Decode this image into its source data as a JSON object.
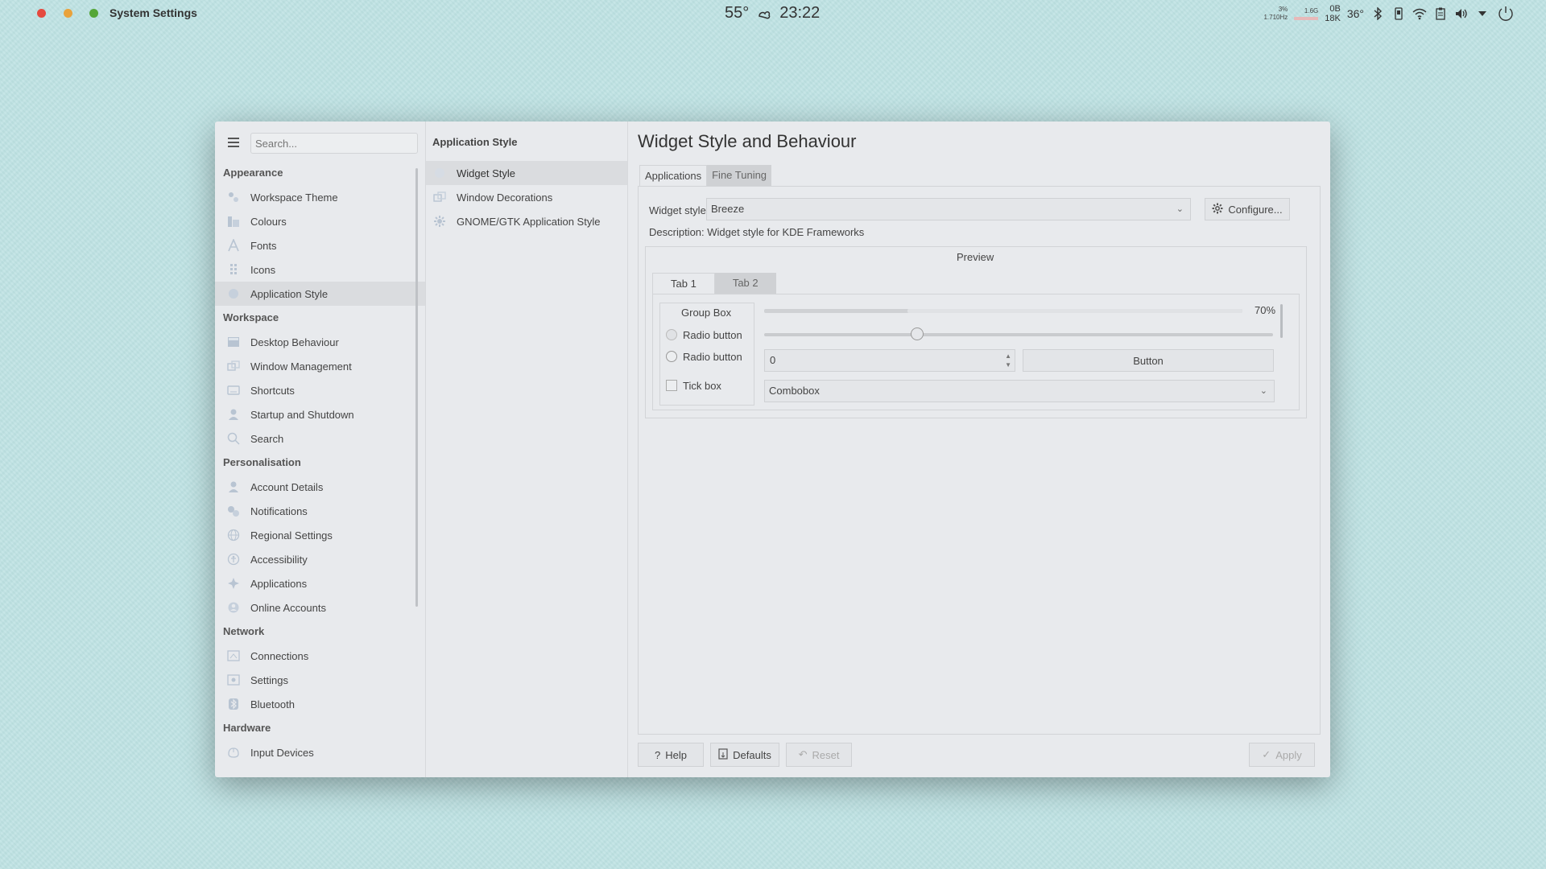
{
  "topbar": {
    "app_title": "System Settings",
    "weather_temp": "55°",
    "clock": "23:22",
    "net_up": "3%",
    "net_freq": "1.710Hz",
    "net_rate": "1.6G",
    "mem_top": "0B",
    "mem_bottom": "18K",
    "cpu_temp": "36°"
  },
  "sidebar": {
    "search_placeholder": "Search...",
    "sections": [
      {
        "heading": "Appearance",
        "items": [
          {
            "label": "Workspace Theme",
            "icon": "workspace-theme-icon"
          },
          {
            "label": "Colours",
            "icon": "colours-icon"
          },
          {
            "label": "Fonts",
            "icon": "fonts-icon"
          },
          {
            "label": "Icons",
            "icon": "icons-icon"
          },
          {
            "label": "Application Style",
            "icon": "application-style-icon"
          }
        ]
      },
      {
        "heading": "Workspace",
        "items": [
          {
            "label": "Desktop Behaviour",
            "icon": "desktop-behaviour-icon"
          },
          {
            "label": "Window Management",
            "icon": "window-management-icon"
          },
          {
            "label": "Shortcuts",
            "icon": "shortcuts-icon"
          },
          {
            "label": "Startup and Shutdown",
            "icon": "startup-shutdown-icon"
          },
          {
            "label": "Search",
            "icon": "search-icon"
          }
        ]
      },
      {
        "heading": "Personalisation",
        "items": [
          {
            "label": "Account Details",
            "icon": "account-details-icon"
          },
          {
            "label": "Notifications",
            "icon": "notifications-icon"
          },
          {
            "label": "Regional Settings",
            "icon": "regional-settings-icon"
          },
          {
            "label": "Accessibility",
            "icon": "accessibility-icon"
          },
          {
            "label": "Applications",
            "icon": "applications-icon"
          },
          {
            "label": "Online Accounts",
            "icon": "online-accounts-icon"
          }
        ]
      },
      {
        "heading": "Network",
        "items": [
          {
            "label": "Connections",
            "icon": "connections-icon"
          },
          {
            "label": "Settings",
            "icon": "network-settings-icon"
          },
          {
            "label": "Bluetooth",
            "icon": "bluetooth-icon"
          }
        ]
      },
      {
        "heading": "Hardware",
        "items": [
          {
            "label": "Input Devices",
            "icon": "input-devices-icon"
          }
        ]
      }
    ]
  },
  "subnav": {
    "title": "Application Style",
    "items": [
      {
        "label": "Widget Style"
      },
      {
        "label": "Window Decorations"
      },
      {
        "label": "GNOME/GTK Application Style"
      }
    ]
  },
  "main": {
    "title": "Widget Style and Behaviour",
    "tabs": [
      {
        "label": "Applications"
      },
      {
        "label": "Fine Tuning"
      }
    ],
    "widget_style_label": "Widget style:",
    "widget_style_value": "Breeze",
    "configure_label": "Configure...",
    "description": "Description: Widget style for KDE Frameworks",
    "preview": {
      "title": "Preview",
      "tabs": [
        {
          "label": "Tab 1"
        },
        {
          "label": "Tab 2"
        }
      ],
      "group_box_title": "Group Box",
      "radio1_label": "Radio button",
      "radio2_label": "Radio button",
      "tickbox_label": "Tick box",
      "progress_text": "70%",
      "progress_value": 0.3,
      "slider_value": 0.3,
      "spinbox_value": "0",
      "button_label": "Button",
      "combobox_value": "Combobox"
    },
    "buttons": {
      "help": "Help",
      "defaults": "Defaults",
      "reset": "Reset",
      "apply": "Apply"
    }
  }
}
